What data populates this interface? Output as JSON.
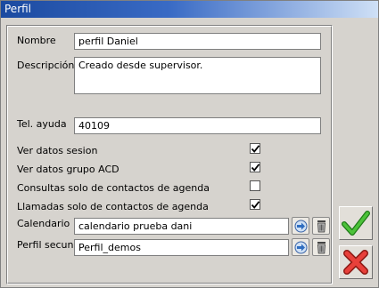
{
  "window": {
    "title": "Perfil"
  },
  "form": {
    "nombre": {
      "label": "Nombre",
      "value": "perfil Daniel"
    },
    "descripcion": {
      "label": "Descripción",
      "value": "Creado desde supervisor."
    },
    "tel_ayuda": {
      "label": "Tel. ayuda",
      "value": "40109"
    },
    "checkboxes": [
      {
        "label": "Ver datos sesion",
        "checked": true
      },
      {
        "label": "Ver datos grupo ACD",
        "checked": true
      },
      {
        "label": "Consultas solo de contactos de agenda",
        "checked": false
      },
      {
        "label": "Llamadas solo de contactos de agenda",
        "checked": true
      }
    ],
    "calendario": {
      "label": "Calendario",
      "value": "calendario prueba dani"
    },
    "perfil_secun": {
      "label": "Perfil secun",
      "value": "Perfil_demos"
    }
  },
  "icons": {
    "select": "arrow-right-icon",
    "delete": "trash-icon",
    "accept": "checkmark-icon",
    "cancel": "x-icon"
  },
  "colors": {
    "accept": "#3aa42c",
    "cancel": "#d9322a",
    "title_start": "#1b4aa0"
  }
}
